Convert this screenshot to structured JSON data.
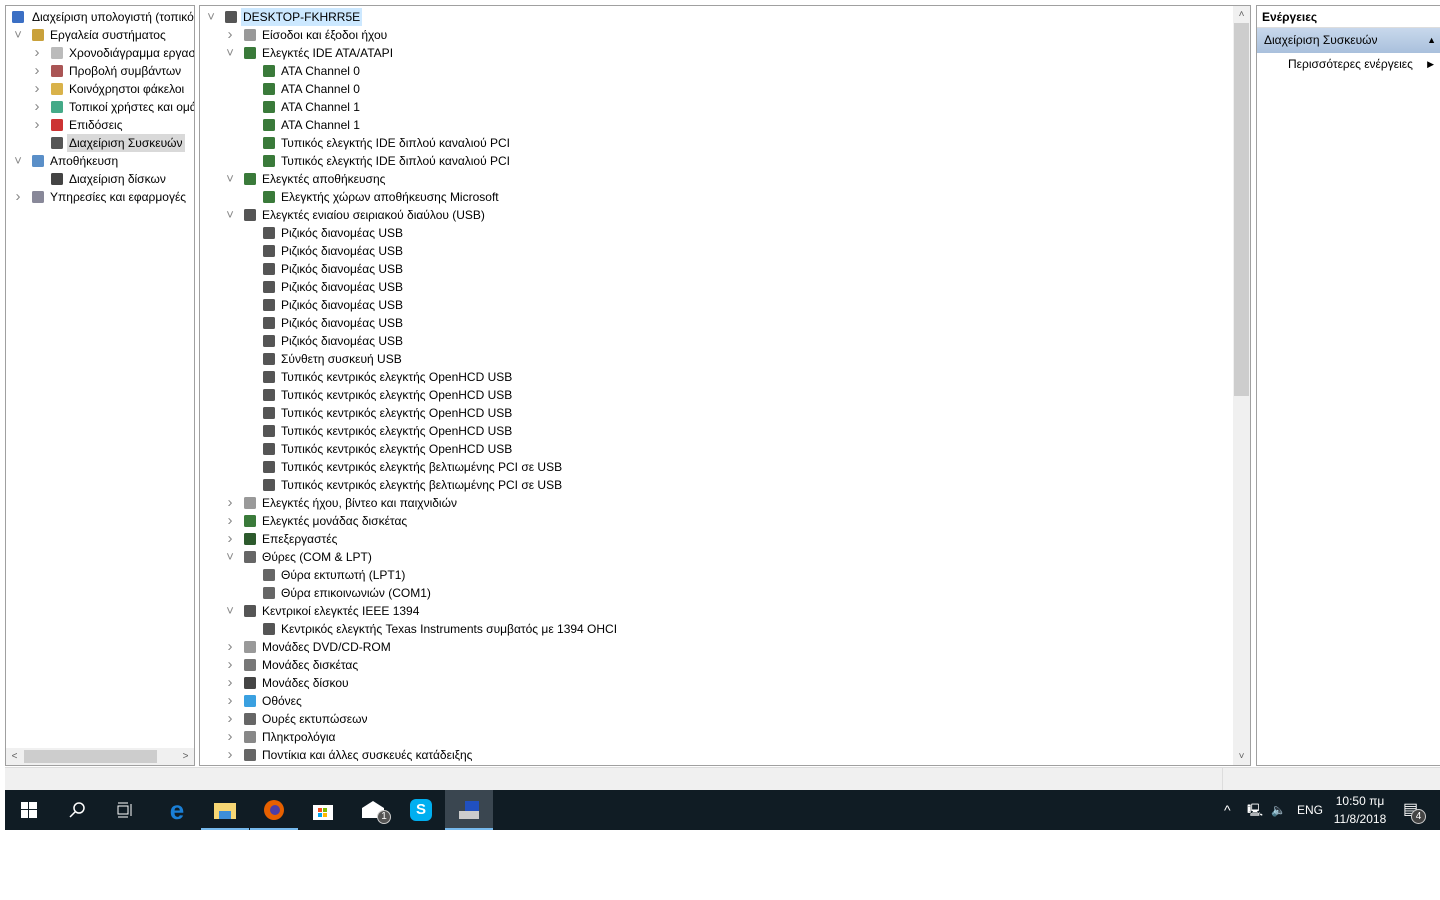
{
  "left_tree": [
    {
      "label": "Διαχείριση υπολογιστή (τοπικός)",
      "level": 0,
      "expand": "",
      "icon": "computer-management-icon"
    },
    {
      "label": "Εργαλεία συστήματος",
      "level": 1,
      "expand": "expanded",
      "icon": "system-tools-icon"
    },
    {
      "label": "Χρονοδιάγραμμα εργασιών",
      "level": 2,
      "expand": "collapsed",
      "icon": "task-scheduler-icon"
    },
    {
      "label": "Προβολή συμβάντων",
      "level": 2,
      "expand": "collapsed",
      "icon": "event-viewer-icon"
    },
    {
      "label": "Κοινόχρηστοι φάκελοι",
      "level": 2,
      "expand": "collapsed",
      "icon": "shared-folders-icon"
    },
    {
      "label": "Τοπικοί χρήστες και ομάδες",
      "level": 2,
      "expand": "collapsed",
      "icon": "local-users-icon"
    },
    {
      "label": "Επιδόσεις",
      "level": 2,
      "expand": "collapsed",
      "icon": "performance-icon"
    },
    {
      "label": "Διαχείριση Συσκευών",
      "level": 2,
      "expand": "",
      "icon": "device-manager-icon",
      "selected": true
    },
    {
      "label": "Αποθήκευση",
      "level": 1,
      "expand": "expanded",
      "icon": "storage-icon"
    },
    {
      "label": "Διαχείριση δίσκων",
      "level": 2,
      "expand": "",
      "icon": "disk-management-icon"
    },
    {
      "label": "Υπηρεσίες και εφαρμογές",
      "level": 1,
      "expand": "collapsed",
      "icon": "services-icon"
    }
  ],
  "device_tree": [
    {
      "label": "DESKTOP-FKHRR5E",
      "level": 0,
      "expand": "expanded",
      "icon": "computer-icon"
    },
    {
      "label": "Είσοδοι και έξοδοι ήχου",
      "level": 1,
      "expand": "collapsed",
      "icon": "speaker-icon"
    },
    {
      "label": "Ελεγκτές IDE ATA/ATAPI",
      "level": 1,
      "expand": "expanded",
      "icon": "ide-icon"
    },
    {
      "label": "ATA Channel 0",
      "level": 2,
      "icon": "ide-icon"
    },
    {
      "label": "ATA Channel 0",
      "level": 2,
      "icon": "ide-icon"
    },
    {
      "label": "ATA Channel 1",
      "level": 2,
      "icon": "ide-icon"
    },
    {
      "label": "ATA Channel 1",
      "level": 2,
      "icon": "ide-icon"
    },
    {
      "label": "Τυπικός ελεγκτής IDE διπλού καναλιού PCI",
      "level": 2,
      "icon": "ide-icon"
    },
    {
      "label": "Τυπικός ελεγκτής IDE διπλού καναλιού PCI",
      "level": 2,
      "icon": "ide-icon"
    },
    {
      "label": "Ελεγκτές αποθήκευσης",
      "level": 1,
      "expand": "expanded",
      "icon": "storage-controller-icon"
    },
    {
      "label": "Ελεγκτής χώρων αποθήκευσης Microsoft",
      "level": 2,
      "icon": "storage-controller-icon"
    },
    {
      "label": "Ελεγκτές ενιαίου σειριακού διαύλου (USB)",
      "level": 1,
      "expand": "expanded",
      "icon": "usb-icon"
    },
    {
      "label": "Ριζικός διανομέας USB",
      "level": 2,
      "icon": "usb-icon"
    },
    {
      "label": "Ριζικός διανομέας USB",
      "level": 2,
      "icon": "usb-icon"
    },
    {
      "label": "Ριζικός διανομέας USB",
      "level": 2,
      "icon": "usb-icon"
    },
    {
      "label": "Ριζικός διανομέας USB",
      "level": 2,
      "icon": "usb-icon"
    },
    {
      "label": "Ριζικός διανομέας USB",
      "level": 2,
      "icon": "usb-icon"
    },
    {
      "label": "Ριζικός διανομέας USB",
      "level": 2,
      "icon": "usb-icon"
    },
    {
      "label": "Ριζικός διανομέας USB",
      "level": 2,
      "icon": "usb-icon"
    },
    {
      "label": "Σύνθετη συσκευή USB",
      "level": 2,
      "icon": "usb-icon"
    },
    {
      "label": "Τυπικός κεντρικός ελεγκτής OpenHCD USB",
      "level": 2,
      "icon": "usb-icon"
    },
    {
      "label": "Τυπικός κεντρικός ελεγκτής OpenHCD USB",
      "level": 2,
      "icon": "usb-icon"
    },
    {
      "label": "Τυπικός κεντρικός ελεγκτής OpenHCD USB",
      "level": 2,
      "icon": "usb-icon"
    },
    {
      "label": "Τυπικός κεντρικός ελεγκτής OpenHCD USB",
      "level": 2,
      "icon": "usb-icon"
    },
    {
      "label": "Τυπικός κεντρικός ελεγκτής OpenHCD USB",
      "level": 2,
      "icon": "usb-icon"
    },
    {
      "label": "Τυπικός κεντρικός ελεγκτής βελτιωμένης PCI σε USB",
      "level": 2,
      "icon": "usb-icon"
    },
    {
      "label": "Τυπικός κεντρικός ελεγκτής βελτιωμένης PCI σε USB",
      "level": 2,
      "icon": "usb-icon"
    },
    {
      "label": "Ελεγκτές ήχου, βίντεο και παιχνιδιών",
      "level": 1,
      "expand": "collapsed",
      "icon": "speaker-icon"
    },
    {
      "label": "Ελεγκτές μονάδας δισκέτας",
      "level": 1,
      "expand": "collapsed",
      "icon": "floppy-controller-icon"
    },
    {
      "label": "Επεξεργαστές",
      "level": 1,
      "expand": "collapsed",
      "icon": "processor-icon"
    },
    {
      "label": "Θύρες (COM & LPT)",
      "level": 1,
      "expand": "expanded",
      "icon": "port-icon"
    },
    {
      "label": "Θύρα εκτυπωτή (LPT1)",
      "level": 2,
      "icon": "port-icon"
    },
    {
      "label": "Θύρα επικοινωνιών (COM1)",
      "level": 2,
      "icon": "port-icon"
    },
    {
      "label": "Κεντρικοί ελεγκτές IEEE 1394",
      "level": 1,
      "expand": "expanded",
      "icon": "usb-icon"
    },
    {
      "label": "Κεντρικός ελεγκτής Texas Instruments συμβατός με 1394 OHCI",
      "level": 2,
      "icon": "usb-icon"
    },
    {
      "label": "Μονάδες DVD/CD-ROM",
      "level": 1,
      "expand": "collapsed",
      "icon": "dvd-icon"
    },
    {
      "label": "Μονάδες δισκέτας",
      "level": 1,
      "expand": "collapsed",
      "icon": "floppy-icon"
    },
    {
      "label": "Μονάδες δίσκου",
      "level": 1,
      "expand": "collapsed",
      "icon": "disk-drive-icon"
    },
    {
      "label": "Οθόνες",
      "level": 1,
      "expand": "collapsed",
      "icon": "monitor-icon"
    },
    {
      "label": "Ουρές εκτυπώσεων",
      "level": 1,
      "expand": "collapsed",
      "icon": "printer-icon"
    },
    {
      "label": "Πληκτρολόγια",
      "level": 1,
      "expand": "collapsed",
      "icon": "keyboard-icon"
    },
    {
      "label": "Ποντίκια και άλλες συσκευές κατάδειξης",
      "level": 1,
      "expand": "collapsed",
      "icon": "mouse-icon"
    }
  ],
  "actions": {
    "title": "Ενέργειες",
    "section": "Διαχείριση Συσκευών",
    "more": "Περισσότερες ενέργειες"
  },
  "taskbar": {
    "apps": [
      "start",
      "search",
      "task-view",
      "edge",
      "file-explorer",
      "firefox",
      "store",
      "mail",
      "skype",
      "computer-management"
    ],
    "mail_badge": "1",
    "lang": "ENG",
    "time": "10:50 πμ",
    "date": "11/8/2018",
    "notif_count": "4"
  }
}
